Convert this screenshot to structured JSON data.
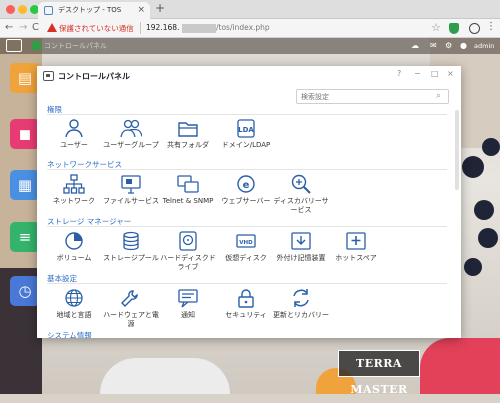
{
  "browser": {
    "tab_title": "デスクトップ - TOS",
    "tab_close": "×",
    "new_tab": "+",
    "insecure_label": "保護されていない通信",
    "url_prefix": "192.168.",
    "url_suffix": "/tos/index.php",
    "nav_back": "←",
    "nav_forward": "→",
    "nav_reload": "C",
    "bookmark_star": "☆",
    "menu": "⋮"
  },
  "tos_bar": {
    "cloud": "☁",
    "bell": "✉",
    "gear": "⚙",
    "user": "●",
    "user_name": "admin"
  },
  "logo": "TERRA MASTER",
  "control_panel": {
    "title": "コントロールパネル",
    "window_buttons": {
      "help": "?",
      "minimize": "−",
      "maximize": "□",
      "close": "×"
    },
    "search_placeholder": "検索設定",
    "search_icon": "⌕",
    "sections": [
      {
        "title": "権限",
        "items": [
          {
            "label": "ユーザー",
            "icon": "user-icon"
          },
          {
            "label": "ユーザーグループ",
            "icon": "user-group-icon"
          },
          {
            "label": "共有フォルダ",
            "icon": "shared-folder-icon"
          },
          {
            "label": "ドメイン/LDAP",
            "icon": "ldap-icon"
          }
        ]
      },
      {
        "title": "ネットワークサービス",
        "items": [
          {
            "label": "ネットワーク",
            "icon": "network-icon"
          },
          {
            "label": "ファイルサービス",
            "icon": "file-service-icon"
          },
          {
            "label": "Telnet & SNMP",
            "icon": "telnet-snmp-icon"
          },
          {
            "label": "ウェブサーバー",
            "icon": "web-server-icon"
          },
          {
            "label": "ディスカバリーサービス",
            "icon": "discovery-icon"
          }
        ]
      },
      {
        "title": "ストレージ マネージャー",
        "items": [
          {
            "label": "ボリューム",
            "icon": "volume-icon"
          },
          {
            "label": "ストレージプール",
            "icon": "storage-pool-icon"
          },
          {
            "label": "ハードディスクドライブ",
            "icon": "hdd-icon"
          },
          {
            "label": "仮想ディスク",
            "icon": "virtual-disk-icon"
          },
          {
            "label": "外付け記憶装置",
            "icon": "external-storage-icon"
          },
          {
            "label": "ホットスペア",
            "icon": "hot-spare-icon"
          }
        ]
      },
      {
        "title": "基本設定",
        "items": [
          {
            "label": "地域と言語",
            "icon": "globe-icon"
          },
          {
            "label": "ハードウェアと電源",
            "icon": "wrench-icon"
          },
          {
            "label": "通知",
            "icon": "notification-icon"
          },
          {
            "label": "セキュリティ",
            "icon": "lock-icon"
          },
          {
            "label": "更新とリカバリー",
            "icon": "update-icon"
          }
        ]
      },
      {
        "title": "システム情報",
        "items": []
      }
    ]
  }
}
